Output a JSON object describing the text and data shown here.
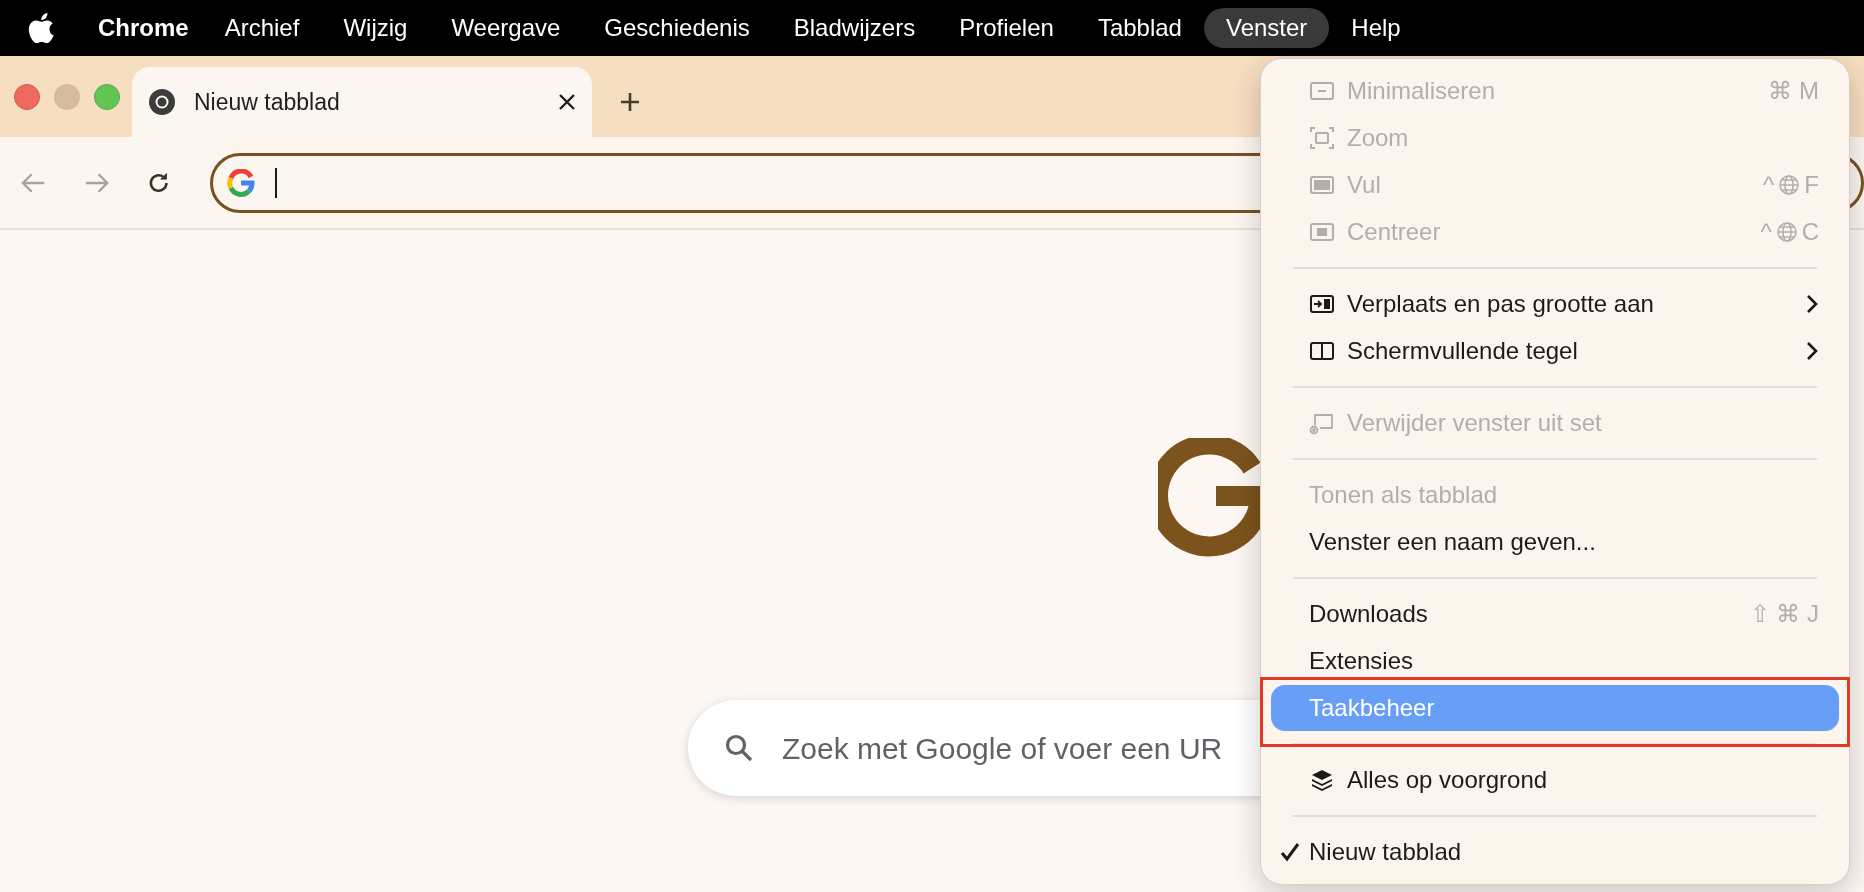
{
  "menu_bar": {
    "app": "Chrome",
    "items": [
      {
        "label": "Archief",
        "selected": false
      },
      {
        "label": "Wijzig",
        "selected": false
      },
      {
        "label": "Weergave",
        "selected": false
      },
      {
        "label": "Geschiedenis",
        "selected": false
      },
      {
        "label": "Bladwijzers",
        "selected": false
      },
      {
        "label": "Profielen",
        "selected": false
      },
      {
        "label": "Tabblad",
        "selected": false
      },
      {
        "label": "Venster",
        "selected": true
      },
      {
        "label": "Help",
        "selected": false
      }
    ]
  },
  "tabs": [
    {
      "label": "Nieuw tabblad",
      "selected": true
    }
  ],
  "toolbar": {
    "address": {
      "focused": true
    }
  },
  "page": {
    "search": {
      "placeholder": "Zoek met Google of voer een UR"
    }
  },
  "menu": [
    {
      "kind": "item",
      "label": "Minimaliseren",
      "disabled": true,
      "shortcut": [
        {
          "kind": "text",
          "label": "⌘ M"
        }
      ]
    },
    {
      "kind": "item",
      "label": "Zoom",
      "disabled": true
    },
    {
      "kind": "item",
      "label": "Vul",
      "disabled": true,
      "shortcut": [
        {
          "kind": "text",
          "label": "^"
        },
        {
          "kind": "globe"
        },
        {
          "kind": "text",
          "label": "F"
        }
      ]
    },
    {
      "kind": "item",
      "label": "Centreer",
      "disabled": true,
      "shortcut": [
        {
          "kind": "text",
          "label": "^"
        },
        {
          "kind": "globe"
        },
        {
          "kind": "text",
          "label": "C"
        }
      ]
    },
    {
      "kind": "separator"
    },
    {
      "kind": "item",
      "label": "Verplaats en pas grootte aan",
      "disabled": false,
      "submenu": true
    },
    {
      "kind": "item",
      "label": "Schermvullende tegel",
      "disabled": false,
      "submenu": true
    },
    {
      "kind": "separator"
    },
    {
      "kind": "item",
      "label": "Verwijder venster uit set",
      "disabled": true
    },
    {
      "kind": "separator"
    },
    {
      "kind": "item",
      "label": "Tonen als tabblad",
      "disabled": true
    },
    {
      "kind": "item",
      "label": "Venster een naam geven...",
      "disabled": false
    },
    {
      "kind": "separator"
    },
    {
      "kind": "item",
      "label": "Downloads",
      "disabled": false,
      "shortcut": [
        {
          "kind": "text",
          "label": "⇧ ⌘ J"
        }
      ]
    },
    {
      "kind": "item",
      "label": "Extensies",
      "disabled": false
    },
    {
      "kind": "item",
      "label": "Taakbeheer",
      "disabled": false,
      "selected": true,
      "annotated": true
    },
    {
      "kind": "separator"
    },
    {
      "kind": "item",
      "label": "Alles op voorgrond",
      "disabled": false
    },
    {
      "kind": "separator"
    },
    {
      "kind": "item",
      "label": "Nieuw tabblad",
      "disabled": false,
      "checked": true
    }
  ]
}
